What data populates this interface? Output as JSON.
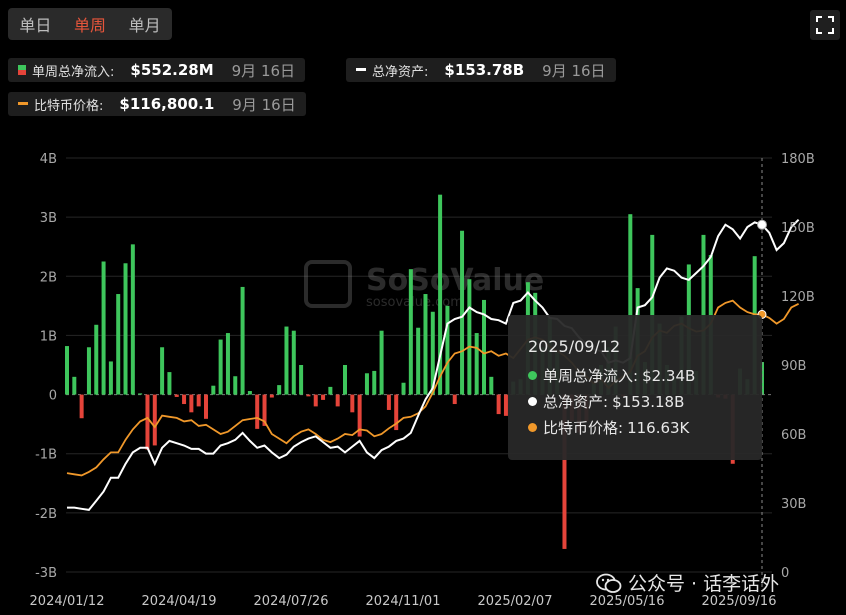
{
  "tabs": [
    {
      "label": "单日",
      "active": false
    },
    {
      "label": "单周",
      "active": true
    },
    {
      "label": "单月",
      "active": false
    }
  ],
  "fullscreen_icon": "fullscreen-icon",
  "legend": {
    "weekly_flow": {
      "label": "单周总净流入:",
      "value": "$552.28M",
      "date": "9月 16日"
    },
    "total_assets": {
      "label": "总净资产:",
      "value": "$153.78B",
      "date": "9月 16日"
    },
    "btc_price": {
      "label": "比特币价格:",
      "value": "$116,800.1",
      "date": "9月 16日"
    }
  },
  "watermark_logo_text": "SoSoValue",
  "watermark_sub": "sosovalue.com",
  "tooltip": {
    "date": "2025/09/12",
    "rows": [
      {
        "label": "单周总净流入:",
        "value": "$2.34B",
        "color": "#3ec65c"
      },
      {
        "label": "总净资产:",
        "value": "$153.18B",
        "color": "#ffffff"
      },
      {
        "label": "比特币价格:",
        "value": "116.63K",
        "color": "#f0982a"
      }
    ]
  },
  "bottom_watermark": "公众号 · 话李话外",
  "colors": {
    "inflow": "#3ec65c",
    "outflow": "#e5443a",
    "assets": "#ffffff",
    "btc": "#f0982a",
    "grid": "#262626"
  },
  "chart_data": {
    "type": "bar",
    "x_start": "2024/01/12",
    "x_end": "2025/09/12",
    "x_tick_labels": [
      "2024/01/12",
      "2024/04/19",
      "2024/07/26",
      "2024/11/01",
      "2025/02/07",
      "2025/05/16",
      "2025/09/16"
    ],
    "left_axis": {
      "ticks": [
        "4B",
        "3B",
        "2B",
        "1B",
        "0",
        "-1B",
        "-2B",
        "-3B"
      ],
      "range": [
        -3,
        4
      ]
    },
    "right_axis": {
      "ticks": [
        "180B",
        "150B",
        "120B",
        "90B",
        "60B",
        "30B",
        "0"
      ],
      "range": [
        0,
        180
      ]
    },
    "series": [
      {
        "name": "单周总净流入",
        "unit": "B",
        "values": [
          0.82,
          0.3,
          -0.4,
          0.8,
          1.18,
          2.25,
          0.56,
          1.7,
          2.22,
          2.54,
          0.02,
          -0.93,
          -0.86,
          0.8,
          0.38,
          -0.04,
          -0.16,
          -0.3,
          -0.2,
          -0.41,
          0.15,
          0.93,
          1.04,
          0.31,
          1.82,
          0.06,
          -0.58,
          -0.53,
          -0.05,
          0.16,
          1.15,
          1.08,
          0.5,
          -0.03,
          -0.2,
          -0.09,
          0.13,
          -0.2,
          0.5,
          -0.3,
          -0.71,
          0.36,
          0.4,
          1.08,
          -0.26,
          -0.6,
          0.2,
          2.12,
          1.13,
          1.7,
          1.4,
          3.38,
          1.5,
          -0.16,
          2.77,
          1.95,
          1.04,
          1.6,
          0.3,
          -0.33,
          -0.36,
          0.22,
          0.26,
          1.9,
          1.72,
          0.8,
          1.3,
          0.73,
          -2.61,
          -0.45,
          -0.64,
          -0.45,
          0.2,
          0.5,
          0.8,
          1.15,
          -0.03,
          3.05,
          1.8,
          0.55,
          2.7,
          1.2,
          0.5,
          0.28,
          1.32,
          2.2,
          0.4,
          2.7,
          2.36,
          -0.05,
          -0.07,
          -1.17,
          0.44,
          0.26,
          2.34,
          0.55
        ]
      },
      {
        "name": "总净资产",
        "unit": "B",
        "values": [
          28,
          28,
          27.5,
          27,
          31,
          35,
          41,
          41,
          47,
          52,
          54,
          54,
          47,
          54,
          57,
          56,
          55,
          53.5,
          53.5,
          51.5,
          51.5,
          55,
          56,
          57.5,
          60.5,
          57,
          54,
          55,
          52,
          49.5,
          51,
          54.5,
          56.5,
          58,
          59,
          56.5,
          54,
          54.5,
          52,
          54.5,
          57,
          52,
          49.5,
          53,
          54.5,
          57,
          58,
          60.5,
          68,
          75,
          80,
          94,
          108,
          110,
          111,
          115,
          113,
          112,
          110,
          109.5,
          108,
          117,
          118,
          121.5,
          118,
          115,
          110.5,
          110,
          107,
          106,
          102,
          99,
          97,
          96,
          91,
          92,
          91,
          93,
          115,
          116,
          119.5,
          128,
          132,
          131,
          128,
          127,
          130,
          133,
          137,
          146,
          151,
          149,
          145,
          150,
          152,
          151,
          147.5,
          140,
          143,
          150,
          153.18
        ]
      },
      {
        "name": "比特币价格",
        "unit": "K",
        "values": [
          43,
          42.5,
          42,
          43.5,
          45.5,
          49,
          52,
          52,
          57.5,
          62,
          65.5,
          67,
          63,
          68,
          67.5,
          67,
          65.5,
          66,
          63.5,
          64,
          62,
          60,
          61,
          63.5,
          66,
          66.5,
          67,
          65.5,
          60,
          58,
          56,
          59,
          61,
          62,
          60,
          57.5,
          56.5,
          58,
          60,
          59.5,
          62,
          61.5,
          59,
          60,
          62.5,
          64.5,
          67,
          67.5,
          69,
          72,
          78,
          85,
          91,
          95,
          96,
          98,
          97.5,
          95,
          96,
          94,
          95,
          93,
          97,
          101,
          102,
          101,
          98,
          96,
          94,
          91,
          87,
          85,
          82,
          84,
          80,
          83,
          85,
          87,
          94,
          96,
          102,
          105,
          104,
          107,
          108,
          106,
          104.5,
          105,
          108,
          115,
          117,
          118,
          115,
          113,
          112,
          112,
          110.5,
          108,
          110,
          115,
          116.63
        ]
      }
    ],
    "x": "weekly dates from 2024/01/12 to 2025/09/12"
  }
}
